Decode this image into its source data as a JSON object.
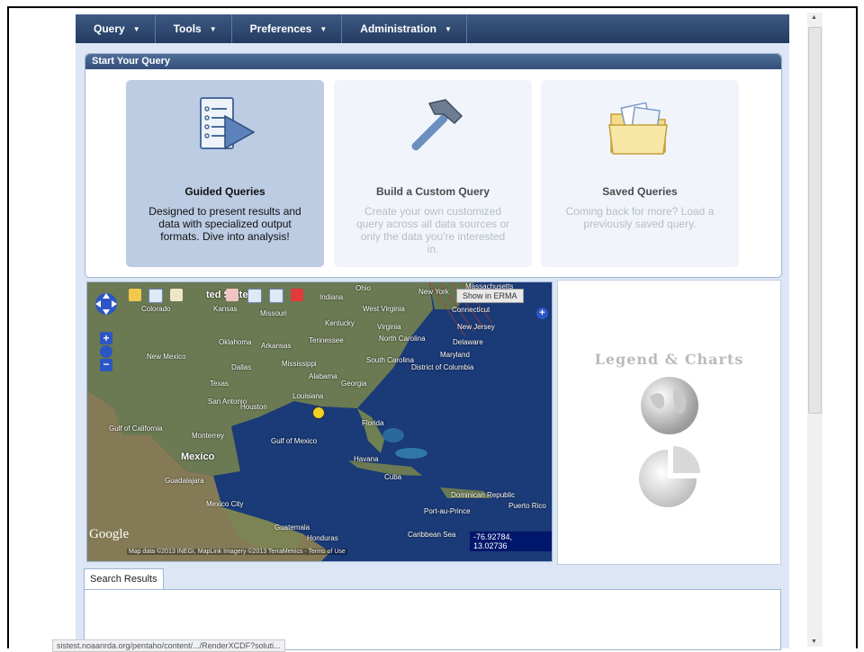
{
  "menu": [
    {
      "label": "Query"
    },
    {
      "label": "Tools"
    },
    {
      "label": "Preferences"
    },
    {
      "label": "Administration"
    }
  ],
  "panel": {
    "title": "Start Your Query"
  },
  "cards": [
    {
      "title": "Guided Queries",
      "description": "Designed to present results and data with specialized output formats. Dive into analysis!"
    },
    {
      "title": "Build a Custom Query",
      "description": "Create your own customized query across all data sources or only the data you're interested in."
    },
    {
      "title": "Saved Queries",
      "description": "Coming back for more? Load a previously saved query."
    }
  ],
  "map": {
    "show_in_erma": "Show in ERMA",
    "coords": "-76.92784, 13.02736",
    "attribution": "Map data ©2013 INEGI, MapLink Imagery ©2013 TerraMetrics - Terms of Use",
    "google": "Google",
    "labels": [
      "Colorado",
      "Kansas",
      "Missouri",
      "Indiana",
      "Ohio",
      "New York",
      "Connecticut",
      "West Virginia",
      "Kentucky",
      "Virginia",
      "New Jersey",
      "Oklahoma",
      "Arkansas",
      "Tennessee",
      "North Carolina",
      "Delaware",
      "Maryland",
      "New Mexico",
      "Dallas",
      "Mississippi",
      "Alabama",
      "South Carolina",
      "District of Columbia",
      "Georgia",
      "Texas",
      "Louisiana",
      "San Antonio",
      "Houston",
      "Florida",
      "Gulf of California",
      "Monterrey",
      "Gulf of Mexico",
      "Mexico",
      "Havana",
      "Cuba",
      "Guadalajara",
      "Mexico City",
      "Dominican Republic",
      "Puerto Rico",
      "Port-au-Prince",
      "Guatemala",
      "Honduras",
      "Caribbean Sea",
      "Massachusetts",
      "ted States"
    ]
  },
  "legend": {
    "title": "Legend & Charts"
  },
  "results": {
    "tab": "Search Results"
  },
  "status_url": "sistest.noaanrda.org/pentaho/content/.../RenderXCDF?soluti..."
}
